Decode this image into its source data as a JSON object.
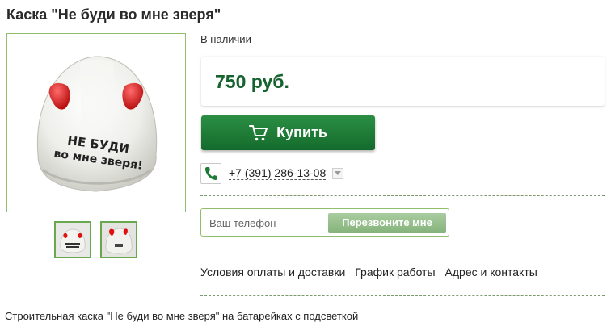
{
  "product": {
    "title": "Каска \"Не буди во мне зверя\"",
    "availability": "В наличии",
    "price": "750 руб.",
    "helmet_text_line1": "НЕ БУДИ",
    "helmet_text_line2": "во мне зверя!",
    "description": "Строительная каска \"Не буди во мне зверя\" на батарейках с подсветкой"
  },
  "buy": {
    "label": "Купить",
    "icon": "cart-icon"
  },
  "contact": {
    "phone": "+7 (391) 286-13-08",
    "phone_icon": "phone-icon",
    "dropdown_icon": "chevron-down-icon"
  },
  "callback": {
    "placeholder": "Ваш телефон",
    "value": "",
    "button_label": "Перезвоните мне"
  },
  "links": [
    "Условия оплаты и доставки",
    "График работы",
    "Адрес и контакты"
  ],
  "colors": {
    "accent_green": "#16632f",
    "button_green": "#2b8e43",
    "callback_button": "#9cc493",
    "border_green": "#8fbf6d"
  }
}
